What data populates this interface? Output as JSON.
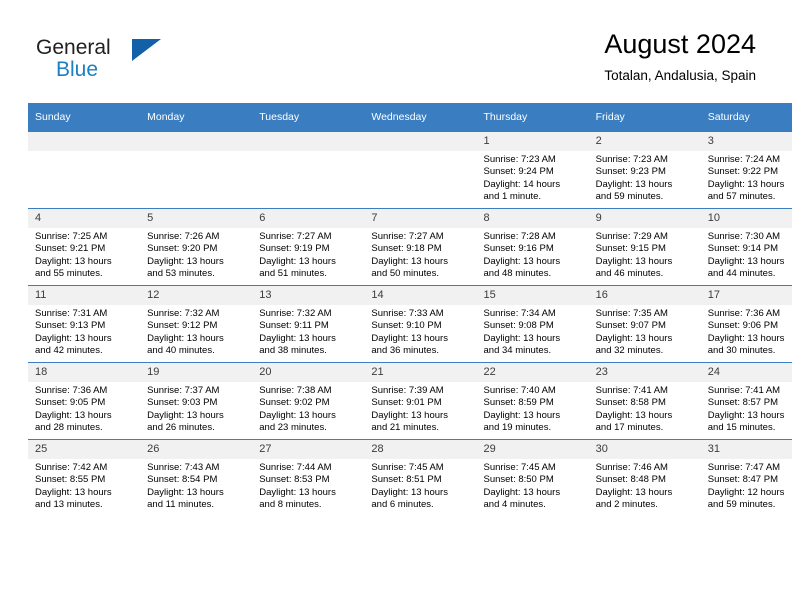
{
  "brand": {
    "word_one": "General",
    "word_two": "Blue",
    "logo_icon": "triangle-logo-icon"
  },
  "header": {
    "title": "August 2024",
    "subtitle": "Totalan, Andalusia, Spain"
  },
  "theme": {
    "header_blue": "#3a7ec1",
    "logo_blue": "#1160a8",
    "brand_blue_text": "#1b7fc4",
    "daynum_bg": "#f1f1f1",
    "page_bg": "#ffffff"
  },
  "calendar": {
    "weekday_headers": [
      "Sunday",
      "Monday",
      "Tuesday",
      "Wednesday",
      "Thursday",
      "Friday",
      "Saturday"
    ],
    "weeks": [
      [
        {
          "day": "",
          "empty": true,
          "lines": []
        },
        {
          "day": "",
          "empty": true,
          "lines": []
        },
        {
          "day": "",
          "empty": true,
          "lines": []
        },
        {
          "day": "",
          "empty": true,
          "lines": []
        },
        {
          "day": "1",
          "empty": false,
          "lines": [
            "Sunrise: 7:23 AM",
            "Sunset: 9:24 PM",
            "Daylight: 14 hours",
            "and 1 minute."
          ]
        },
        {
          "day": "2",
          "empty": false,
          "lines": [
            "Sunrise: 7:23 AM",
            "Sunset: 9:23 PM",
            "Daylight: 13 hours",
            "and 59 minutes."
          ]
        },
        {
          "day": "3",
          "empty": false,
          "lines": [
            "Sunrise: 7:24 AM",
            "Sunset: 9:22 PM",
            "Daylight: 13 hours",
            "and 57 minutes."
          ]
        }
      ],
      [
        {
          "day": "4",
          "empty": false,
          "lines": [
            "Sunrise: 7:25 AM",
            "Sunset: 9:21 PM",
            "Daylight: 13 hours",
            "and 55 minutes."
          ]
        },
        {
          "day": "5",
          "empty": false,
          "lines": [
            "Sunrise: 7:26 AM",
            "Sunset: 9:20 PM",
            "Daylight: 13 hours",
            "and 53 minutes."
          ]
        },
        {
          "day": "6",
          "empty": false,
          "lines": [
            "Sunrise: 7:27 AM",
            "Sunset: 9:19 PM",
            "Daylight: 13 hours",
            "and 51 minutes."
          ]
        },
        {
          "day": "7",
          "empty": false,
          "lines": [
            "Sunrise: 7:27 AM",
            "Sunset: 9:18 PM",
            "Daylight: 13 hours",
            "and 50 minutes."
          ]
        },
        {
          "day": "8",
          "empty": false,
          "lines": [
            "Sunrise: 7:28 AM",
            "Sunset: 9:16 PM",
            "Daylight: 13 hours",
            "and 48 minutes."
          ]
        },
        {
          "day": "9",
          "empty": false,
          "lines": [
            "Sunrise: 7:29 AM",
            "Sunset: 9:15 PM",
            "Daylight: 13 hours",
            "and 46 minutes."
          ]
        },
        {
          "day": "10",
          "empty": false,
          "lines": [
            "Sunrise: 7:30 AM",
            "Sunset: 9:14 PM",
            "Daylight: 13 hours",
            "and 44 minutes."
          ]
        }
      ],
      [
        {
          "day": "11",
          "empty": false,
          "lines": [
            "Sunrise: 7:31 AM",
            "Sunset: 9:13 PM",
            "Daylight: 13 hours",
            "and 42 minutes."
          ]
        },
        {
          "day": "12",
          "empty": false,
          "lines": [
            "Sunrise: 7:32 AM",
            "Sunset: 9:12 PM",
            "Daylight: 13 hours",
            "and 40 minutes."
          ]
        },
        {
          "day": "13",
          "empty": false,
          "lines": [
            "Sunrise: 7:32 AM",
            "Sunset: 9:11 PM",
            "Daylight: 13 hours",
            "and 38 minutes."
          ]
        },
        {
          "day": "14",
          "empty": false,
          "lines": [
            "Sunrise: 7:33 AM",
            "Sunset: 9:10 PM",
            "Daylight: 13 hours",
            "and 36 minutes."
          ]
        },
        {
          "day": "15",
          "empty": false,
          "lines": [
            "Sunrise: 7:34 AM",
            "Sunset: 9:08 PM",
            "Daylight: 13 hours",
            "and 34 minutes."
          ]
        },
        {
          "day": "16",
          "empty": false,
          "lines": [
            "Sunrise: 7:35 AM",
            "Sunset: 9:07 PM",
            "Daylight: 13 hours",
            "and 32 minutes."
          ]
        },
        {
          "day": "17",
          "empty": false,
          "lines": [
            "Sunrise: 7:36 AM",
            "Sunset: 9:06 PM",
            "Daylight: 13 hours",
            "and 30 minutes."
          ]
        }
      ],
      [
        {
          "day": "18",
          "empty": false,
          "lines": [
            "Sunrise: 7:36 AM",
            "Sunset: 9:05 PM",
            "Daylight: 13 hours",
            "and 28 minutes."
          ]
        },
        {
          "day": "19",
          "empty": false,
          "lines": [
            "Sunrise: 7:37 AM",
            "Sunset: 9:03 PM",
            "Daylight: 13 hours",
            "and 26 minutes."
          ]
        },
        {
          "day": "20",
          "empty": false,
          "lines": [
            "Sunrise: 7:38 AM",
            "Sunset: 9:02 PM",
            "Daylight: 13 hours",
            "and 23 minutes."
          ]
        },
        {
          "day": "21",
          "empty": false,
          "lines": [
            "Sunrise: 7:39 AM",
            "Sunset: 9:01 PM",
            "Daylight: 13 hours",
            "and 21 minutes."
          ]
        },
        {
          "day": "22",
          "empty": false,
          "lines": [
            "Sunrise: 7:40 AM",
            "Sunset: 8:59 PM",
            "Daylight: 13 hours",
            "and 19 minutes."
          ]
        },
        {
          "day": "23",
          "empty": false,
          "lines": [
            "Sunrise: 7:41 AM",
            "Sunset: 8:58 PM",
            "Daylight: 13 hours",
            "and 17 minutes."
          ]
        },
        {
          "day": "24",
          "empty": false,
          "lines": [
            "Sunrise: 7:41 AM",
            "Sunset: 8:57 PM",
            "Daylight: 13 hours",
            "and 15 minutes."
          ]
        }
      ],
      [
        {
          "day": "25",
          "empty": false,
          "lines": [
            "Sunrise: 7:42 AM",
            "Sunset: 8:55 PM",
            "Daylight: 13 hours",
            "and 13 minutes."
          ]
        },
        {
          "day": "26",
          "empty": false,
          "lines": [
            "Sunrise: 7:43 AM",
            "Sunset: 8:54 PM",
            "Daylight: 13 hours",
            "and 11 minutes."
          ]
        },
        {
          "day": "27",
          "empty": false,
          "lines": [
            "Sunrise: 7:44 AM",
            "Sunset: 8:53 PM",
            "Daylight: 13 hours",
            "and 8 minutes."
          ]
        },
        {
          "day": "28",
          "empty": false,
          "lines": [
            "Sunrise: 7:45 AM",
            "Sunset: 8:51 PM",
            "Daylight: 13 hours",
            "and 6 minutes."
          ]
        },
        {
          "day": "29",
          "empty": false,
          "lines": [
            "Sunrise: 7:45 AM",
            "Sunset: 8:50 PM",
            "Daylight: 13 hours",
            "and 4 minutes."
          ]
        },
        {
          "day": "30",
          "empty": false,
          "lines": [
            "Sunrise: 7:46 AM",
            "Sunset: 8:48 PM",
            "Daylight: 13 hours",
            "and 2 minutes."
          ]
        },
        {
          "day": "31",
          "empty": false,
          "lines": [
            "Sunrise: 7:47 AM",
            "Sunset: 8:47 PM",
            "Daylight: 12 hours",
            "and 59 minutes."
          ]
        }
      ]
    ]
  }
}
